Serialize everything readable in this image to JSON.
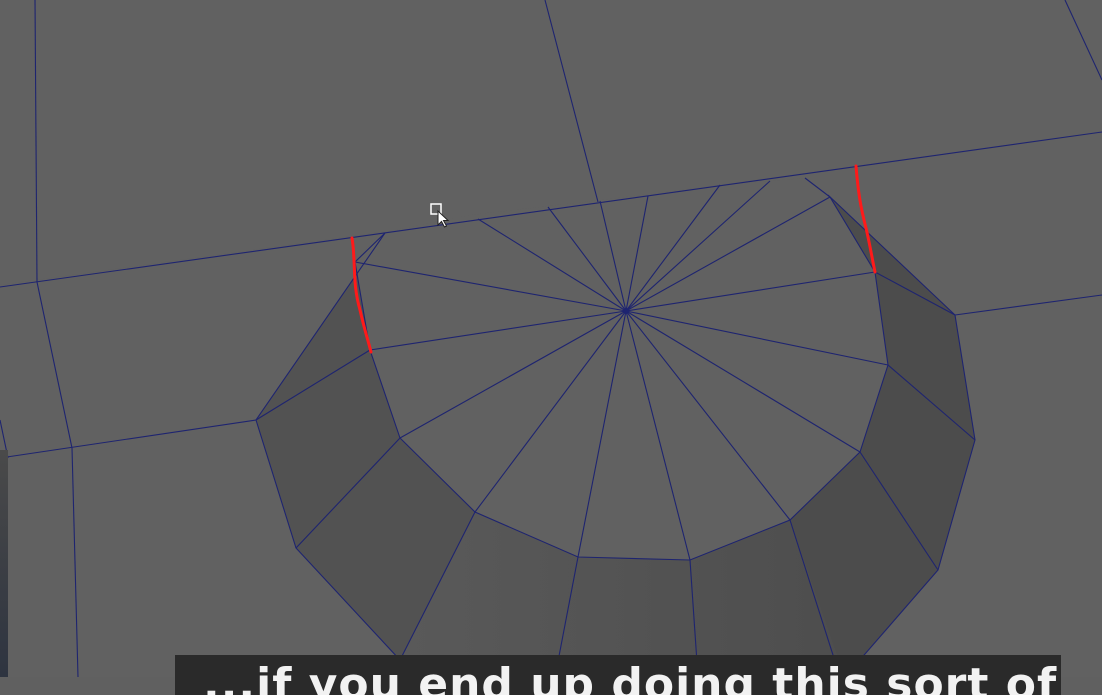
{
  "app": {
    "name": "3D modeling viewport"
  },
  "viewport": {
    "background_color": "#616161",
    "wire_color": "#1e2470",
    "highlight_color": "#ff1a1a",
    "icons": [
      "select-cursor-icon"
    ]
  },
  "subtitle": {
    "text": "...if you end up doing this sort of thing, like this..."
  }
}
